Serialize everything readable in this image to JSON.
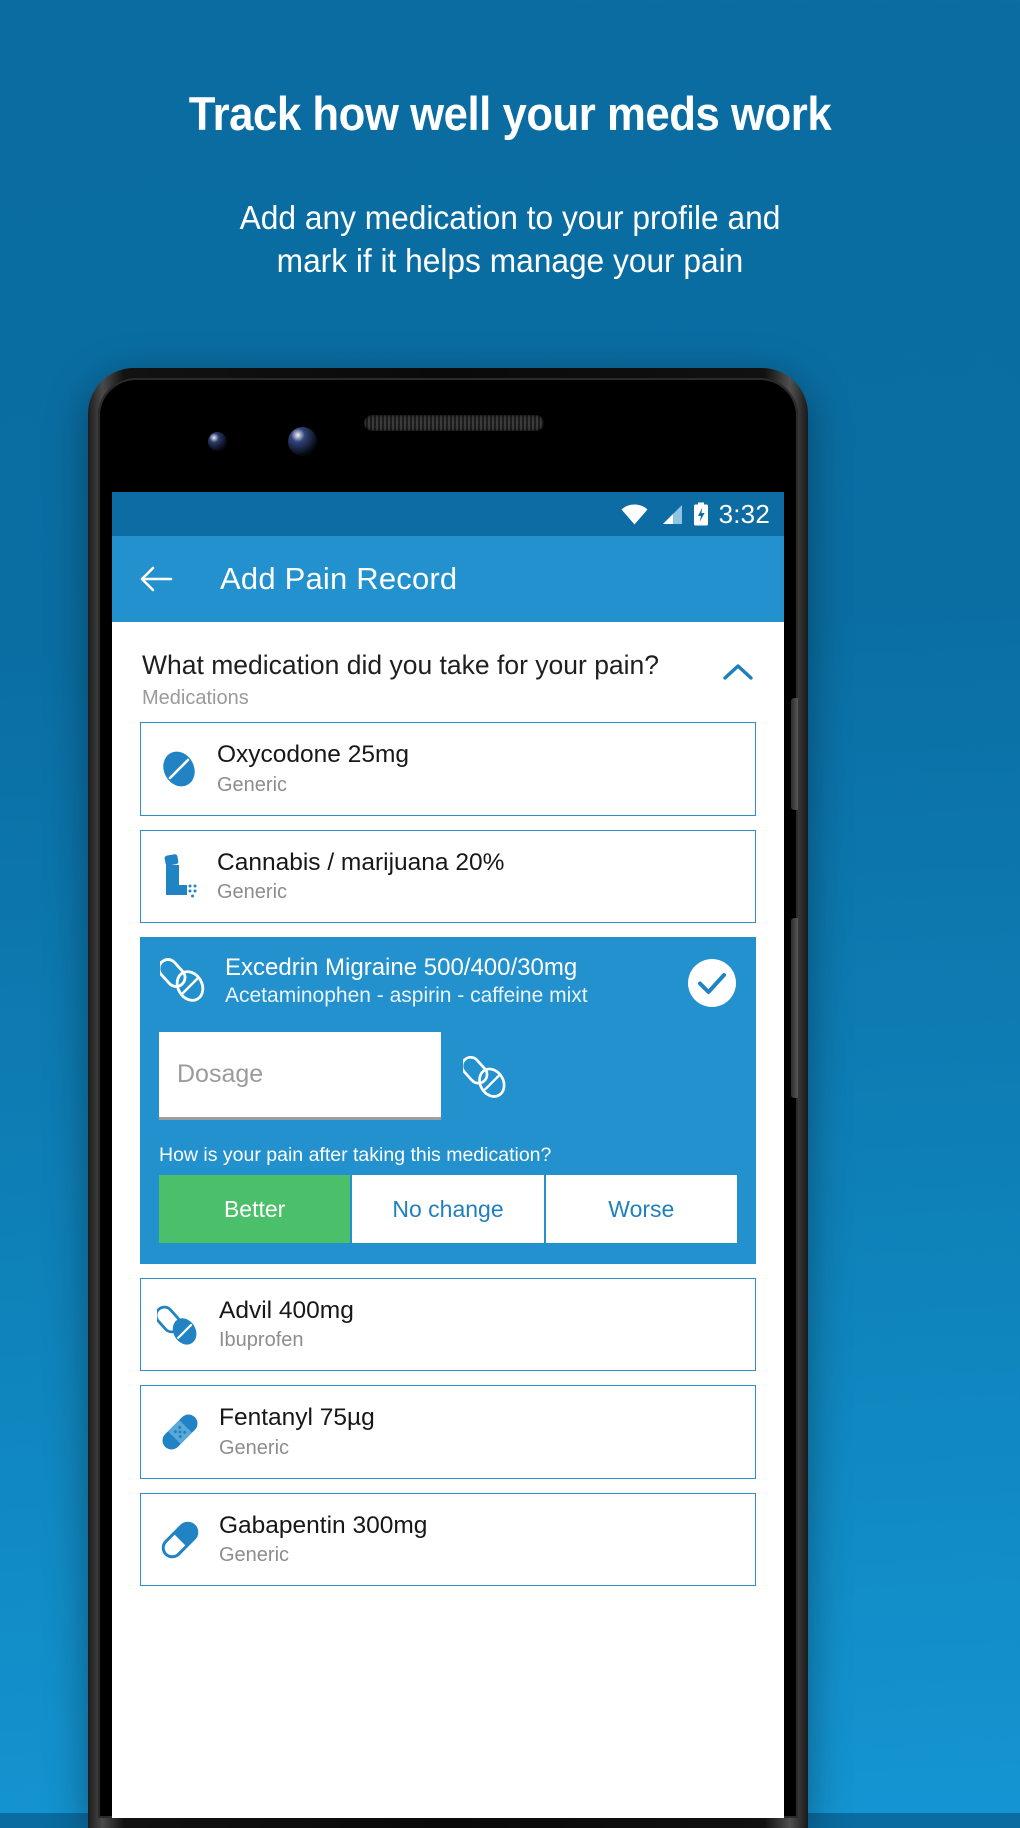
{
  "promo": {
    "headline": "Track how well your meds work",
    "subtitle_line1": "Add any medication to your profile and",
    "subtitle_line2": "mark if it helps manage your pain",
    "background_color": "#0a6ca0",
    "accent_color": "#2291ce"
  },
  "statusbar": {
    "time": "3:32",
    "wifi_icon": "wifi-icon",
    "signal_icon": "cellular-signal-icon",
    "battery_icon": "battery-charging-icon",
    "background_color": "#0d6ca3"
  },
  "appbar": {
    "back_icon": "back-arrow-icon",
    "title": "Add Pain Record",
    "background_color": "#2291ce"
  },
  "section": {
    "question": "What medication did you take for your pain?",
    "subtitle": "Medications",
    "collapse_icon": "chevron-up-icon",
    "collapse_color": "#1d7fbc"
  },
  "medications": [
    {
      "title": "Oxycodone 25mg",
      "subtitle": "Generic",
      "icon": "round-pill-icon",
      "selected": false
    },
    {
      "title": "Cannabis / marijuana 20%",
      "subtitle": "Generic",
      "icon": "inhaler-icon",
      "selected": false
    },
    {
      "title": "Excedrin Migraine 500/400/30mg",
      "subtitle": "Acetaminophen - aspirin - caffeine mixt",
      "icon": "capsule-and-pill-icon",
      "selected": true,
      "check_icon": "check-circle-icon",
      "dosage_placeholder": "Dosage",
      "dosage_value": "",
      "dosage_icon": "capsule-and-pill-icon",
      "pain_question": "How is your pain after taking this medication?",
      "pain_options": [
        {
          "label": "Better",
          "active": true,
          "color": "#4cbf6a"
        },
        {
          "label": "No change",
          "active": false,
          "color": "#ffffff"
        },
        {
          "label": "Worse",
          "active": false,
          "color": "#ffffff"
        }
      ]
    },
    {
      "title": "Advil 400mg",
      "subtitle": "Ibuprofen",
      "icon": "capsule-and-pill-icon",
      "selected": false
    },
    {
      "title": "Fentanyl 75µg",
      "subtitle": "Generic",
      "icon": "bandage-patch-icon",
      "selected": false
    },
    {
      "title": "Gabapentin 300mg",
      "subtitle": "Generic",
      "icon": "capsule-icon",
      "selected": false
    }
  ]
}
